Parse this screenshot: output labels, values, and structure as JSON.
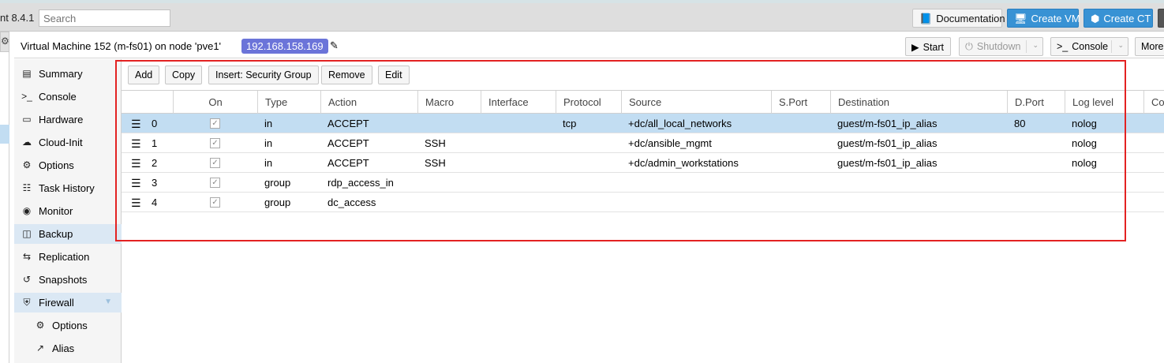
{
  "topbar": {
    "version": "nt 8.4.1",
    "search_placeholder": "Search",
    "documentation": "Documentation",
    "create_vm": "Create VM",
    "create_ct": "Create CT"
  },
  "vm_header": {
    "title": "Virtual Machine 152 (m-fs01) on node 'pve1'",
    "ip": "192.168.158.169",
    "start": "Start",
    "shutdown": "Shutdown",
    "console": "Console",
    "more": "More"
  },
  "nav": {
    "items": [
      {
        "label": "Summary",
        "icon": "book-icon"
      },
      {
        "label": "Console",
        "icon": "terminal-icon"
      },
      {
        "label": "Hardware",
        "icon": "desktop-icon"
      },
      {
        "label": "Cloud-Init",
        "icon": "cloud-icon"
      },
      {
        "label": "Options",
        "icon": "gear-icon"
      },
      {
        "label": "Task History",
        "icon": "list-icon"
      },
      {
        "label": "Monitor",
        "icon": "eye-icon"
      },
      {
        "label": "Backup",
        "icon": "floppy-icon"
      },
      {
        "label": "Replication",
        "icon": "retweet-icon"
      },
      {
        "label": "Snapshots",
        "icon": "history-icon"
      },
      {
        "label": "Firewall",
        "icon": "shield-icon"
      },
      {
        "label": "Options",
        "icon": "gear-icon"
      },
      {
        "label": "Alias",
        "icon": "external-link-icon"
      }
    ]
  },
  "toolbar": {
    "add": "Add",
    "copy": "Copy",
    "insert_sg": "Insert: Security Group",
    "remove": "Remove",
    "edit": "Edit"
  },
  "grid": {
    "columns": [
      "On",
      "Type",
      "Action",
      "Macro",
      "Interface",
      "Protocol",
      "Source",
      "S.Port",
      "Destination",
      "D.Port",
      "Log level",
      "Co"
    ],
    "rows": [
      {
        "n": "0",
        "type": "in",
        "action": "ACCEPT",
        "macro": "",
        "interface": "",
        "protocol": "tcp",
        "source": "+dc/all_local_networks",
        "sport": "",
        "dest": "guest/m-fs01_ip_alias",
        "dport": "80",
        "log": "nolog"
      },
      {
        "n": "1",
        "type": "in",
        "action": "ACCEPT",
        "macro": "SSH",
        "interface": "",
        "protocol": "",
        "source": "+dc/ansible_mgmt",
        "sport": "",
        "dest": "guest/m-fs01_ip_alias",
        "dport": "",
        "log": "nolog"
      },
      {
        "n": "2",
        "type": "in",
        "action": "ACCEPT",
        "macro": "SSH",
        "interface": "",
        "protocol": "",
        "source": "+dc/admin_workstations",
        "sport": "",
        "dest": "guest/m-fs01_ip_alias",
        "dport": "",
        "log": "nolog"
      },
      {
        "n": "3",
        "type": "group",
        "action": "rdp_access_in",
        "macro": "",
        "interface": "",
        "protocol": "",
        "source": "",
        "sport": "",
        "dest": "",
        "dport": "",
        "log": ""
      },
      {
        "n": "4",
        "type": "group",
        "action": "dc_access",
        "macro": "",
        "interface": "",
        "protocol": "",
        "source": "",
        "sport": "",
        "dest": "",
        "dport": "",
        "log": ""
      }
    ]
  }
}
